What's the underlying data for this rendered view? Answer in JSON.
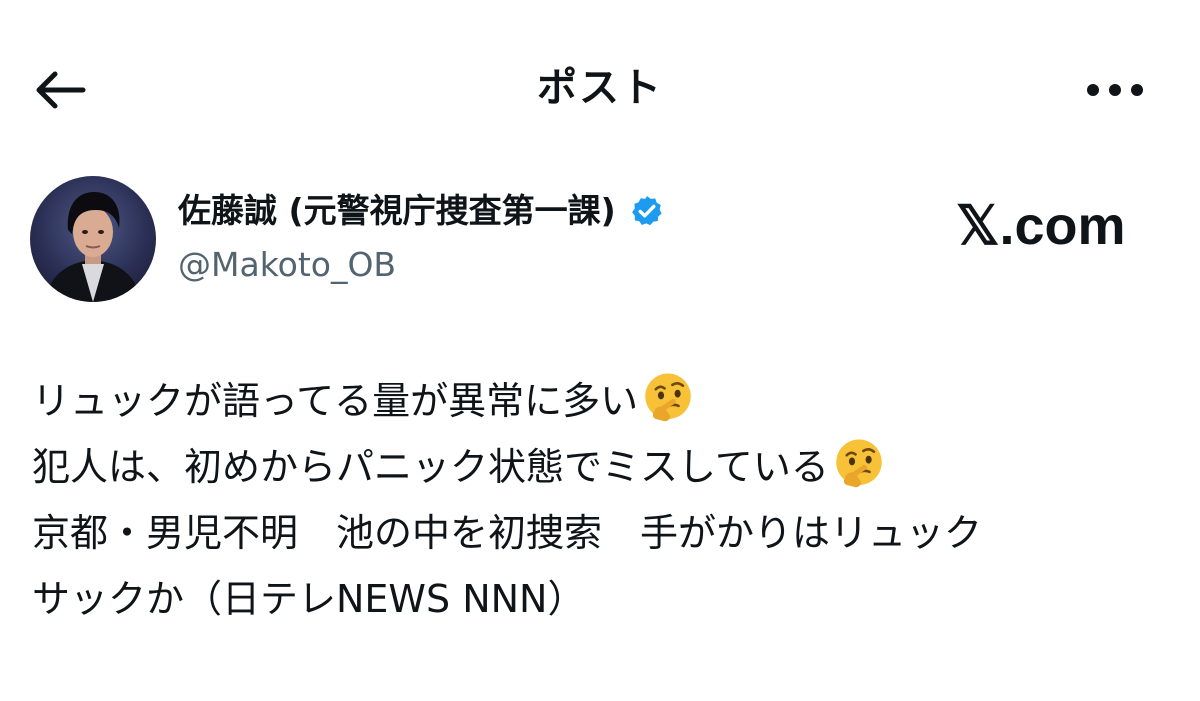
{
  "header": {
    "title": "ポスト",
    "back_icon": "arrow-left-icon",
    "more_icon": "more-horizontal-icon"
  },
  "author": {
    "display_name": "佐藤誠 (元警視庁捜査第一課)",
    "handle": "@Makoto_OB",
    "verified_icon": "verified-badge-icon",
    "verified_color": "#1d9bf0"
  },
  "brand": {
    "text": "𝕏.com"
  },
  "post": {
    "lines": [
      "リュックが語ってる量が異常に多い",
      "犯人は、初めからパニック状態でミスしている",
      "京都・男児不明　池の中を初捜索　手がかりはリュック",
      "サックか（日テレNEWS NNN）"
    ],
    "emoji_icon": "thinking-face-emoji"
  },
  "colors": {
    "text_primary": "#0f1419",
    "text_secondary": "#536471",
    "background": "#ffffff"
  }
}
